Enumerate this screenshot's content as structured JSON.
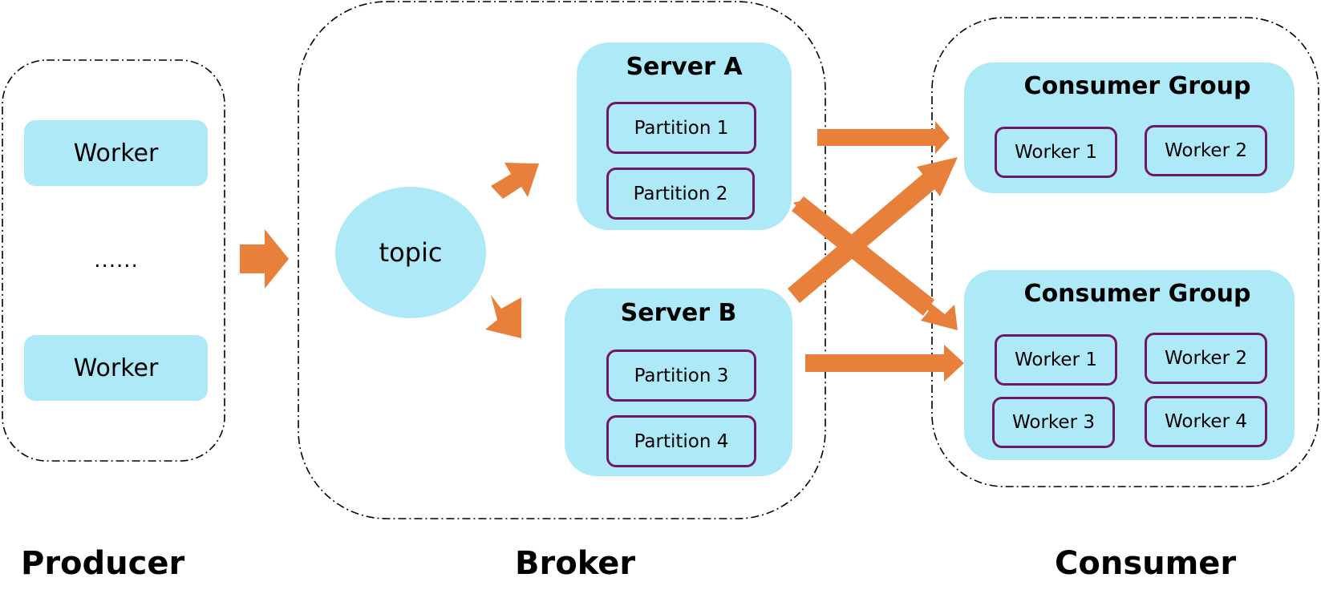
{
  "colors": {
    "box_fill": "#aee9f8",
    "partition_border": "#70176b",
    "arrow": "#e87f3a",
    "container_border": "#000000"
  },
  "producer": {
    "label": "Producer",
    "workers": [
      "Worker",
      "Worker"
    ],
    "ellipsis": "......"
  },
  "broker": {
    "label": "Broker",
    "topic": "topic",
    "servers": [
      {
        "name": "Server A",
        "partitions": [
          "Partition 1",
          "Partition 2"
        ]
      },
      {
        "name": "Server B",
        "partitions": [
          "Partition 3",
          "Partition 4"
        ]
      }
    ]
  },
  "consumer": {
    "label": "Consumer",
    "groups": [
      {
        "name": "Consumer Group",
        "workers": [
          "Worker 1",
          "Worker 2"
        ]
      },
      {
        "name": "Consumer Group",
        "workers": [
          "Worker 1",
          "Worker 2",
          "Worker 3",
          "Worker 4"
        ]
      }
    ]
  },
  "flows": [
    {
      "from": "producer",
      "to": "broker"
    },
    {
      "from": "topic",
      "to": "Server A"
    },
    {
      "from": "topic",
      "to": "Server B"
    },
    {
      "from": "Server A",
      "to": "Consumer Group 1"
    },
    {
      "from": "Server A",
      "to": "Consumer Group 2"
    },
    {
      "from": "Server B",
      "to": "Consumer Group 1"
    },
    {
      "from": "Server B",
      "to": "Consumer Group 2"
    }
  ]
}
